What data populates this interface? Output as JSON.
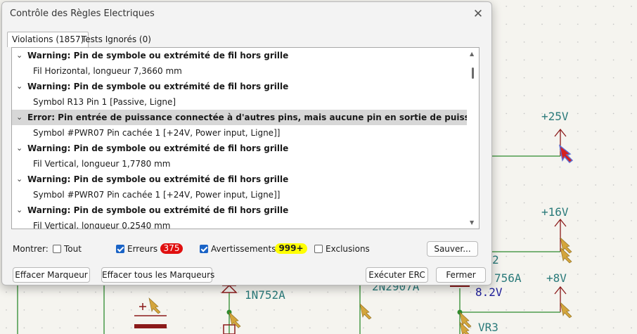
{
  "dialog": {
    "title": "Contrôle des Règles Electriques",
    "close_glyph": "✕",
    "tabs": [
      {
        "label": "Violations (1857)"
      },
      {
        "label": "Tests Ignorés (0)"
      }
    ],
    "violations": [
      {
        "header": "Warning: Pin de symbole ou extrémité de fil hors grille",
        "detail": "Fil Horizontal, longueur 7,3660 mm"
      },
      {
        "header": "Warning: Pin de symbole ou extrémité de fil hors grille",
        "detail": "Symbol R13 Pin 1 [Passive, Ligne]"
      },
      {
        "header": "Error: Pin entrée de puissance connectée à d'autres pins, mais aucune pin en sortie de puissance pour la piloter",
        "detail": "Symbol #PWR07 Pin cachée 1 [+24V, Power input, Ligne]]"
      },
      {
        "header": "Warning: Pin de symbole ou extrémité de fil hors grille",
        "detail": "Fil Vertical, longueur 1,7780 mm"
      },
      {
        "header": "Warning: Pin de symbole ou extrémité de fil hors grille",
        "detail": "Symbol #PWR07 Pin cachée 1 [+24V, Power input, Ligne]]"
      },
      {
        "header": "Warning: Pin de symbole ou extrémité de fil hors grille",
        "detail": "Fil Vertical, longueur 0,2540 mm"
      }
    ],
    "selected_index": 2,
    "chevron_glyph": "⌄",
    "filters": {
      "show_label": "Montrer:",
      "all_label": "Tout",
      "all_checked": false,
      "errors_label": "Erreurs",
      "errors_checked": true,
      "errors_count": "375",
      "warnings_label": "Avertissements",
      "warnings_checked": true,
      "warnings_count": "999+",
      "exclusions_label": "Exclusions",
      "exclusions_checked": false
    },
    "buttons": {
      "save": "Sauver...",
      "clear_marker": "Effacer Marqueur",
      "clear_all_markers": "Effacer tous les Marqueurs",
      "run_erc": "Exécuter ERC",
      "close": "Fermer"
    }
  },
  "schematic": {
    "labels": {
      "v25": "+25V",
      "v16": "+16V",
      "v8": "+8V",
      "part_756a": "756A",
      "volt_82": "8.2V",
      "vr3": "VR3",
      "diode": "1N752A",
      "transistor": "2N2907A",
      "digit2": "2"
    },
    "colors": {
      "wire": "#2e8b2e",
      "power": "#8b1a1a",
      "text": "#2a7a7a",
      "marker": "#c89a3a",
      "grid": "#c7c7c7"
    }
  }
}
